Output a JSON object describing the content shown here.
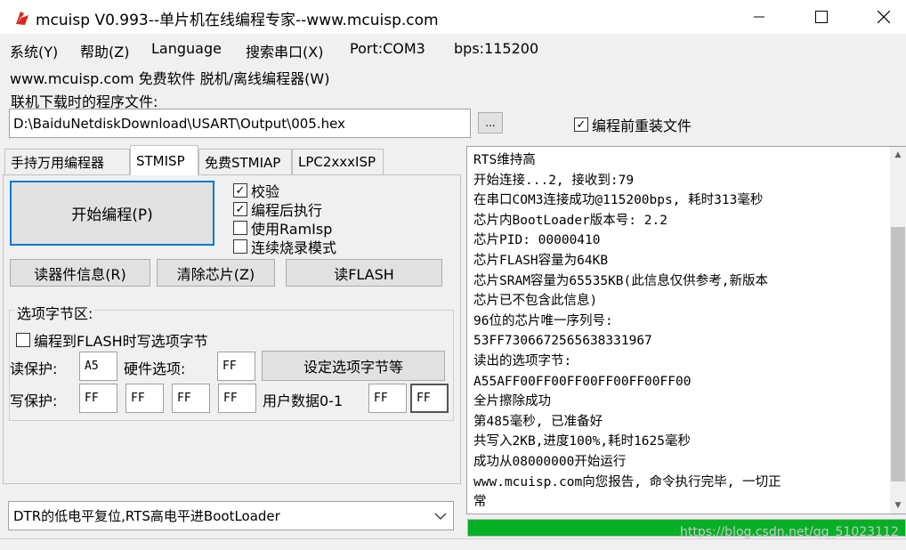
{
  "window": {
    "title": "mcuisp V0.993--单片机在线编程专家--www.mcuisp.com",
    "minimize_icon": "minimize-icon",
    "maximize_icon": "maximize-icon",
    "close_icon": "close-icon"
  },
  "menu": {
    "items": [
      "系统(Y)",
      "帮助(Z)",
      "Language",
      "搜索串口(X)",
      "Port:COM3",
      "bps:115200"
    ],
    "line2": "www.mcuisp.com 免费软件 脱机/离线编程器(W)"
  },
  "file": {
    "label": "联机下载时的程序文件:",
    "path": "D:\\BaiduNetdiskDownload\\USART\\Output\\005.hex",
    "browse_label": "...",
    "reload_label": "编程前重装文件",
    "reload_checked": true
  },
  "tabs": [
    "手持万用编程器",
    "STMISP",
    "免费STMIAP",
    "LPC2xxxISP"
  ],
  "stmisp": {
    "start_label": "开始编程(P)",
    "options": [
      {
        "label": "校验",
        "checked": true
      },
      {
        "label": "编程后执行",
        "checked": true
      },
      {
        "label": "使用RamIsp",
        "checked": false
      },
      {
        "label": "连续烧录模式",
        "checked": false
      }
    ],
    "read_info_label": "读器件信息(R)",
    "erase_label": "清除芯片(Z)",
    "read_flash_label": "读FLASH"
  },
  "option_bytes": {
    "group_label": "选项字节区:",
    "write_on_flash_label": "编程到FLASH时写选项字节",
    "write_on_flash_checked": false,
    "read_protect_label": "读保护:",
    "read_protect_value": "A5",
    "hardware_label": "硬件选项:",
    "hardware_value": "FF",
    "set_button_label": "设定选项字节等",
    "write_protect_label": "写保护:",
    "write_protect_values": [
      "FF",
      "FF",
      "FF",
      "FF"
    ],
    "user_data_label": "用户数据0-1",
    "user_data_values": [
      "FF",
      "FF"
    ]
  },
  "mode_select": {
    "value": "DTR的低电平复位,RTS高电平进BootLoader",
    "arrow_icon": "chevron-down-icon"
  },
  "log": {
    "lines": [
      "RTS维持高",
      "开始连接...2, 接收到:79",
      "在串口COM3连接成功@115200bps, 耗时313毫秒",
      "芯片内BootLoader版本号: 2.2",
      "芯片PID: 00000410",
      "芯片FLASH容量为64KB",
      "芯片SRAM容量为65535KB(此信息仅供参考,新版本",
      "芯片已不包含此信息)",
      "96位的芯片唯一序列号:",
      "53FF7306672565638331967",
      "读出的选项字节:",
      "A55AFF00FF00FF00FF00FF00FF00",
      "全片擦除成功",
      "第485毫秒, 已准备好",
      "共写入2KB,进度100%,耗时1625毫秒",
      "成功从08000000开始运行",
      "www.mcuisp.com向您报告, 命令执行完毕, 一切正",
      "常"
    ]
  },
  "progress": {
    "fraction": 1.0,
    "color": "#06b025"
  },
  "watermark": "https://blog.csdn.net/qq_51023112",
  "colors": {
    "accent": "#0078d7",
    "app_icon": "#d42a1f"
  }
}
